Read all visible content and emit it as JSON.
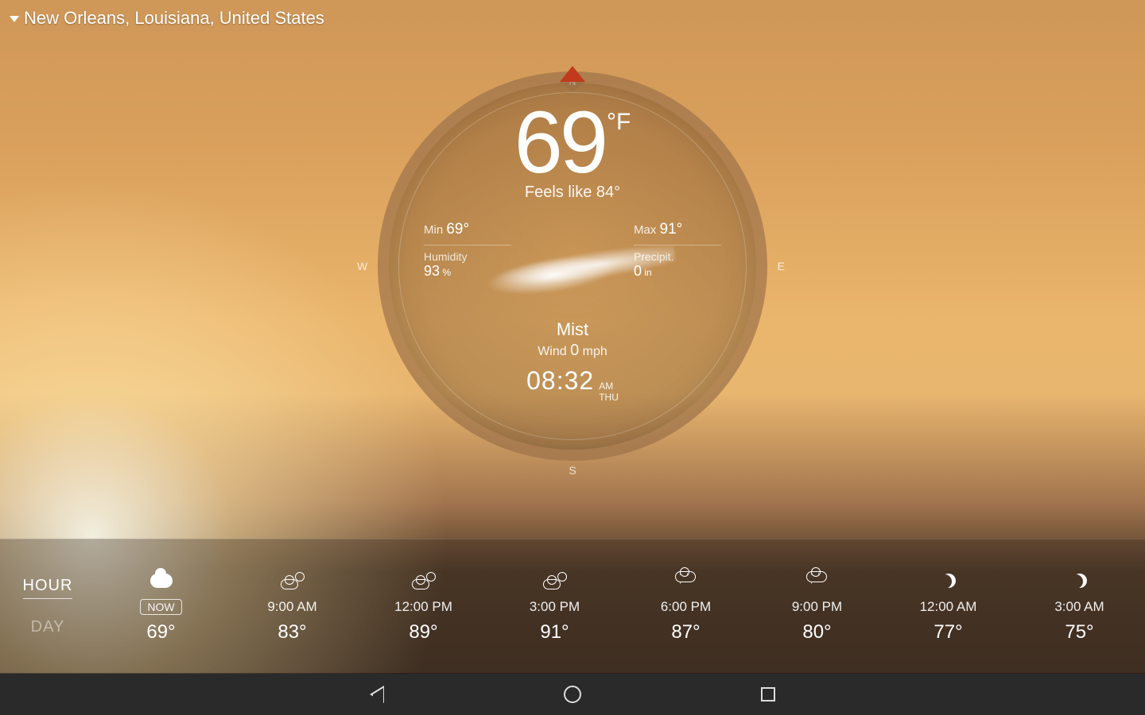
{
  "location": {
    "name": "New Orleans, Louisiana, United States"
  },
  "compass": {
    "n": "N",
    "s": "S",
    "e": "E",
    "w": "W"
  },
  "current": {
    "temp": "69",
    "unit": "°F",
    "feels_like": "Feels like 84°",
    "min_label": "Min",
    "min_value": "69°",
    "max_label": "Max",
    "max_value": "91°",
    "humidity_label": "Humidity",
    "humidity_value": "93",
    "humidity_unit": " %",
    "precip_label": "Precipit.",
    "precip_value": "0",
    "precip_unit": " in",
    "condition": "Mist",
    "wind_label": "Wind ",
    "wind_value": "0",
    "wind_unit": " mph",
    "time": "08:32",
    "ampm": "AM",
    "dow": "THU"
  },
  "tabs": {
    "hour": "HOUR",
    "day": "DAY",
    "active": "hour"
  },
  "forecast": [
    {
      "time": "NOW",
      "temp": "69°",
      "icon": "cloud-fill",
      "now": true
    },
    {
      "time": "9:00 AM",
      "temp": "83°",
      "icon": "suncloud"
    },
    {
      "time": "12:00 PM",
      "temp": "89°",
      "icon": "suncloud"
    },
    {
      "time": "3:00 PM",
      "temp": "91°",
      "icon": "suncloud"
    },
    {
      "time": "6:00 PM",
      "temp": "87°",
      "icon": "rain"
    },
    {
      "time": "9:00 PM",
      "temp": "80°",
      "icon": "rain"
    },
    {
      "time": "12:00 AM",
      "temp": "77°",
      "icon": "moon"
    },
    {
      "time": "3:00 AM",
      "temp": "75°",
      "icon": "moon"
    }
  ]
}
